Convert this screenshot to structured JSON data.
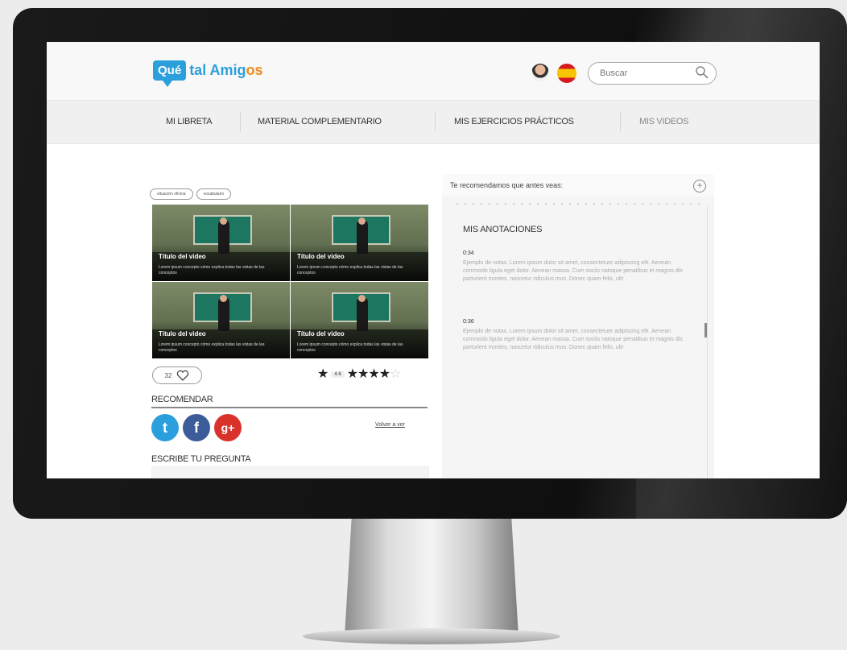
{
  "brand": {
    "badge": "Qué",
    "name_main": "tal Amig",
    "name_accent": "os"
  },
  "search": {
    "placeholder": "Buscar"
  },
  "nav": {
    "items": [
      "MI LIBRETA",
      "MATERIAL COMPLEMENTARIO",
      "MIS EJERCICIOS PRÁCTICOS",
      "MIS VIDEOS"
    ]
  },
  "tags": [
    "situación oficina",
    "vocabulario"
  ],
  "videos": [
    {
      "title": "Título del video",
      "desc": "Lorem ipsum concepto cómo explica todas las vistas de las conceptos"
    },
    {
      "title": "Título del video",
      "desc": "Lorem ipsum concepto cómo explica todas las vistas de las conceptos"
    },
    {
      "title": "Título del video",
      "desc": "Lorem ipsum concepto cómo explica todas las vistas de las conceptos"
    },
    {
      "title": "Título del video",
      "desc": "Lorem ipsum concepto cómo explica todas las vistas de las conceptos"
    }
  ],
  "likes": {
    "count": "32"
  },
  "rating": {
    "value": "4.6",
    "stars_filled": 4,
    "stars_total": 5
  },
  "recommend": {
    "label": "RECOMENDAR",
    "later": "Volver a ver"
  },
  "social": {
    "twitter": "t",
    "facebook": "f",
    "googleplus": "g+"
  },
  "ask": {
    "label": "ESCRIBE TU PREGUNTA"
  },
  "sidebar": {
    "header": "Te recomendamos que antes veas:",
    "notes_title": "MIS ANOTACIONES",
    "notes": [
      {
        "time": "0:34",
        "text": "Ejemplo de notas. Lorem ipsum dolor sit amet, consectetuer adipiscing elit. Aenean commodo ligula eget dolor. Aenean massa. Cum sociis natoque penatibus et magnis dis parturient montes, nascetur ridiculus mus. Donec quam felis, ultr"
      },
      {
        "time": "0:36",
        "text": "Ejemplo de notas. Lorem ipsum dolor sit amet, consectetuer adipiscing elit. Aenean commodo ligula eget dolor. Aenean massa. Cum sociis natoque penatibus et magnis dis parturient montes, nascetur ridiculus mus. Donec quam felis, ultr"
      }
    ]
  },
  "colors": {
    "brand_blue": "#2ba0dc",
    "brand_orange": "#f08a1e",
    "twitter": "#2b9fde",
    "facebook": "#3b5b99",
    "googleplus": "#d9322a"
  }
}
